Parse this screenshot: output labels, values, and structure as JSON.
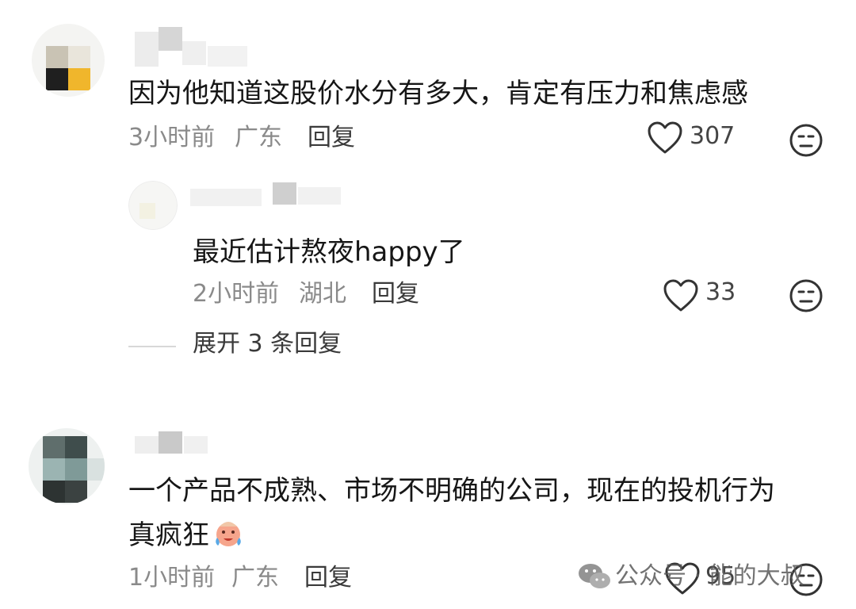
{
  "comments": [
    {
      "text": "因为他知道这股价水分有多大，肯定有压力和焦虑感",
      "time": "3小时前",
      "location": "广东",
      "reply_label": "回复",
      "likes": "307"
    },
    {
      "text": "最近估计熬夜happy了",
      "time": "2小时前",
      "location": "湖北",
      "reply_label": "回复",
      "likes": "33"
    },
    {
      "text_line1": "一个产品不成熟、市场不明确的公司，现在的投机行为",
      "text_line2": "真疯狂",
      "time": "1小时前",
      "location": "广东",
      "reply_label": "回复",
      "likes": "95"
    }
  ],
  "expand_replies": "展开 3 条回复",
  "watermark": "公众号 · 能的大叔",
  "icons": {
    "like": "heart-outline-icon",
    "dislike": "neutral-face-icon",
    "emoji": "crying-face-emoji",
    "watermark_logo": "wechat-logo"
  },
  "colors": {
    "meta_text": "#8a8a8a",
    "body_text": "#161616"
  }
}
